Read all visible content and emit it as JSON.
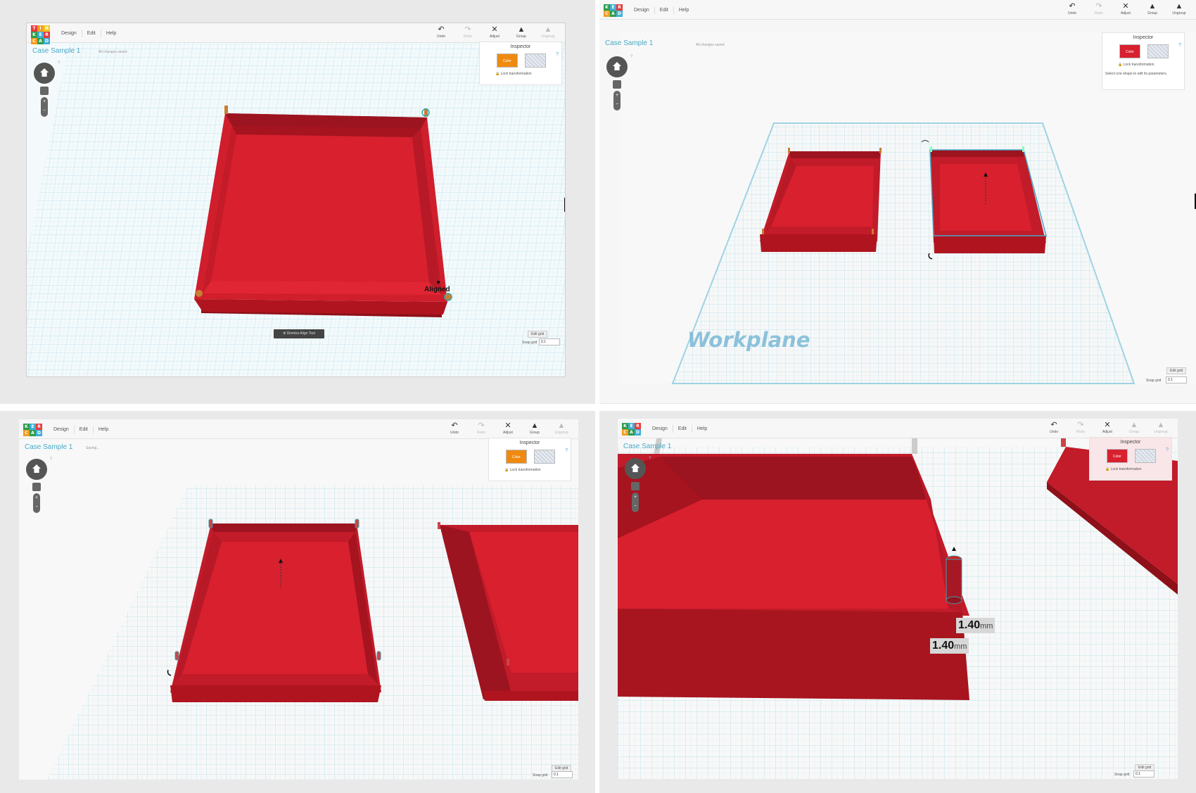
{
  "colors": {
    "accent": "#49a9c7",
    "box_red": "#d8202f",
    "box_red_dark": "#a8151f",
    "box_red_mid": "#c21b29",
    "grid": "#cde9f1",
    "orange": "#ef8a10"
  },
  "logo": {
    "left_letters": [
      "T",
      "I",
      "N",
      "K",
      "E",
      "R",
      "C",
      "A",
      "D"
    ],
    "right_letters": [
      "K",
      "E",
      "R",
      "C",
      "A",
      "D"
    ]
  },
  "menu": [
    "Design",
    "Edit",
    "Help"
  ],
  "toolbar": {
    "undo": "Undo",
    "redo": "Redo",
    "adjust": "Adjust",
    "group": "Group",
    "ungroup": "Ungroup"
  },
  "project_title": "Case Sample 1",
  "panels": [
    {
      "status": "All changes saved",
      "inspector": {
        "title": "Inspector",
        "color_label": "Color",
        "lock_label": "Lock transformation",
        "help": "?"
      },
      "selected_color": "orange",
      "aligned_label": "Aligned",
      "dismiss_label": "Dismiss Align Tool",
      "edit_grid": "Edit grid",
      "snap_grid_label": "Snap grid",
      "snap_grid_value": "0.1"
    },
    {
      "status": "All changes saved",
      "inspector": {
        "title": "Inspector",
        "color_label": "Color",
        "lock_label": "Lock transformation",
        "help": "?",
        "message": "Select one shape to edit its parameters."
      },
      "selected_color": "red",
      "workplane_label": "Workplane",
      "edit_grid": "Edit grid",
      "snap_grid_label": "Snap grid",
      "snap_grid_value": "0.1"
    },
    {
      "status": "Saving...",
      "inspector": {
        "title": "Inspector",
        "color_label": "Color",
        "lock_label": "Lock transformation",
        "help": "?"
      },
      "selected_color": "orange",
      "edit_grid": "Edit grid",
      "snap_grid_label": "Snap grid",
      "snap_grid_value": "0.1"
    },
    {
      "inspector": {
        "title": "Inspector",
        "color_label": "Color",
        "lock_label": "Lock transformation",
        "help": "?"
      },
      "selected_color": "red",
      "dimensions": [
        {
          "value": "1.40",
          "unit": "mm"
        },
        {
          "value": "1.40",
          "unit": "mm"
        }
      ],
      "edit_grid": "Edit grid",
      "snap_grid_label": "Snap grid",
      "snap_grid_value": "0.1"
    }
  ]
}
